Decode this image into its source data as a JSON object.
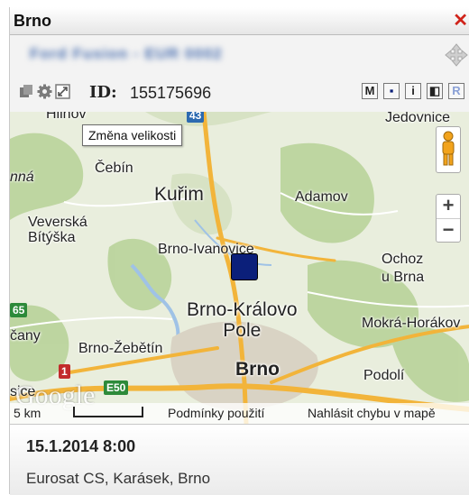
{
  "window": {
    "title": "Brno",
    "close_icon": "close-icon"
  },
  "vehicle": {
    "name": "Ford Fusion - EUR 0002",
    "move_icon": "move-icon"
  },
  "toolbar": {
    "icons": [
      "copy-icon",
      "gear-icon",
      "resize-icon"
    ],
    "id_label": "ID:",
    "id_value": "155175696",
    "buttons": [
      {
        "name": "map-mode-button",
        "label": "M"
      },
      {
        "name": "marker-button",
        "label": "▪"
      },
      {
        "name": "info-button",
        "label": "i"
      },
      {
        "name": "panel-button",
        "label": "◧"
      },
      {
        "name": "route-button",
        "label": "R"
      }
    ]
  },
  "map": {
    "tooltip": "Změna velikosti",
    "places": {
      "hlinsko_partial": "Hlinov",
      "jedovnice": "Jedovnice",
      "cebin": "Čebín",
      "inna": "nná",
      "kurim": "Kuřim",
      "adamov": "Adamov",
      "veverska": "Veverská\nBítýška",
      "brno_ivanovice": "Brno-Ivanovice",
      "ochoz": "Ochoz\nu Brna",
      "brno_kralovo_pole": "Brno-Královo\nPole",
      "mokra_horakov": "Mokrá-Horákov",
      "rozdrojovice_partial": "čany",
      "brno_zebetin": "Brno-Žebětín",
      "brno": "Brno",
      "podoli": "Podolí"
    },
    "road_labels": {
      "r43": "43",
      "r1": "1",
      "r65": "65",
      "e50": "E50",
      "sice": "sice"
    },
    "logo": "Google",
    "scale": "5 km",
    "terms": "Podmínky použití",
    "report": "Nahlásit chybu v mapě",
    "zoom_in": "+",
    "zoom_out": "−",
    "colors": {
      "marker": "#0b1f7a",
      "motorway": "#f2b43a",
      "water": "#9fc2e6"
    }
  },
  "event": {
    "datetime": "15.1.2014 8:00",
    "address": "Eurosat CS, Karásek, Brno"
  }
}
